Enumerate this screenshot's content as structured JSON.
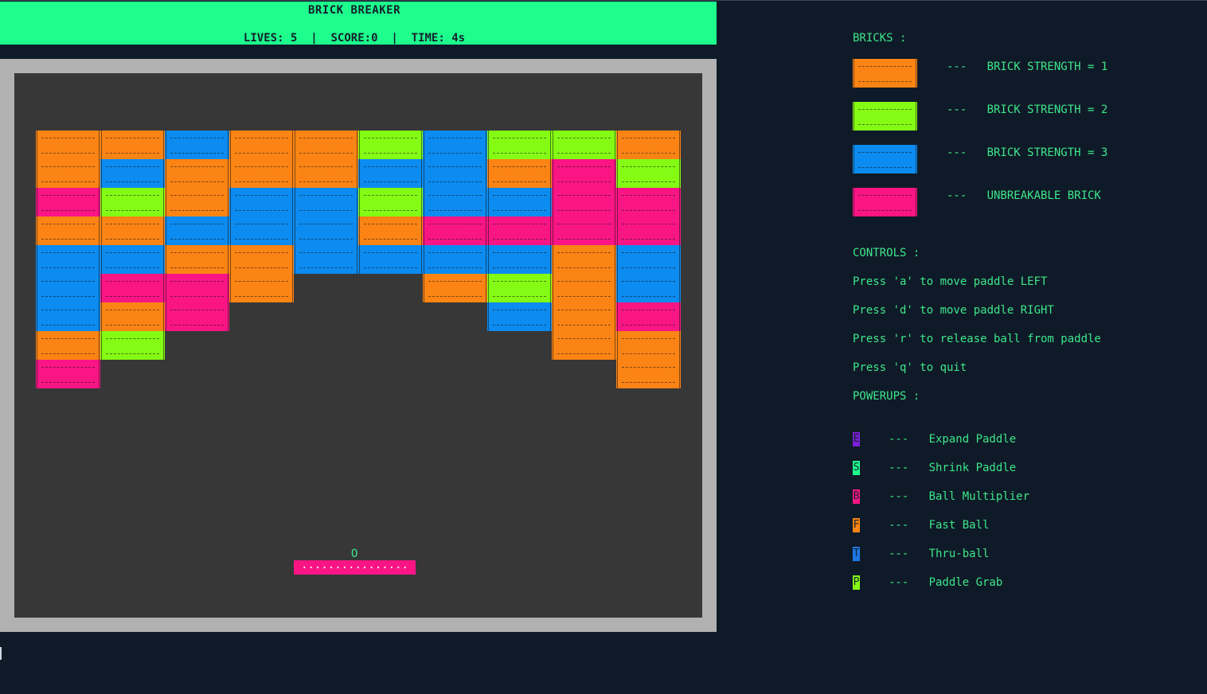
{
  "colors": {
    "background": "#0f1a28",
    "header_bg": "#1dfe8d",
    "text": "#3ee68a",
    "frame": "#b1b1b1",
    "arena": "#373737",
    "brick_strength_1": "#fc8414",
    "brick_strength_2": "#84fb14",
    "brick_strength_3": "#0c8bf0",
    "brick_unbreakable": "#fa1585",
    "paddle": "#fa1585"
  },
  "header": {
    "title": "BRICK BREAKER",
    "status": "LIVES: 5  |  SCORE:0  |  TIME: 4s"
  },
  "game": {
    "ball_char": "O",
    "paddle_text": "................",
    "brick_grid": [
      [
        "O",
        "O",
        "B",
        "O",
        "O",
        "G",
        "B",
        "G",
        "G",
        "O"
      ],
      [
        "O",
        "B",
        "O",
        "O",
        "O",
        "B",
        "B",
        "O",
        "P",
        "G"
      ],
      [
        "P",
        "G",
        "O",
        "B",
        "B",
        "G",
        "B",
        "B",
        "P",
        "P"
      ],
      [
        "O",
        "O",
        "B",
        "B",
        "B",
        "O",
        "P",
        "P",
        "P",
        "P"
      ],
      [
        "B",
        "B",
        "O",
        "O",
        "B",
        "B",
        "B",
        "B",
        "O",
        "B"
      ],
      [
        "B",
        "P",
        "P",
        "O",
        ".",
        ".",
        "O",
        "G",
        "O",
        "B"
      ],
      [
        "B",
        "O",
        "P",
        ".",
        ".",
        ".",
        ".",
        "B",
        "O",
        "P"
      ],
      [
        "O",
        "G",
        ".",
        ".",
        ".",
        ".",
        ".",
        ".",
        "O",
        "O"
      ],
      [
        "P",
        ".",
        ".",
        ".",
        ".",
        ".",
        ".",
        ".",
        ".",
        "O"
      ]
    ]
  },
  "legend": {
    "bricks_heading": "BRICKS :",
    "bricks": [
      {
        "desc": "---   BRICK STRENGTH = 1",
        "color": "#fc8414"
      },
      {
        "desc": "---   BRICK STRENGTH = 2",
        "color": "#84fb14"
      },
      {
        "desc": "---   BRICK STRENGTH = 3",
        "color": "#0c8bf0"
      },
      {
        "desc": "---   UNBREAKABLE BRICK",
        "color": "#fa1585"
      }
    ],
    "controls_heading": "CONTROLS :",
    "controls": [
      "Press 'a' to move paddle LEFT",
      "Press 'd' to move paddle RIGHT",
      "Press 'r' to release ball from paddle",
      "Press 'q' to quit"
    ],
    "powerups_heading": "POWERUPS :",
    "powerups": [
      {
        "key": "E",
        "desc": "---   Expand Paddle",
        "color": "#7a1fd6",
        "icon": "expand-paddle-icon"
      },
      {
        "key": "S",
        "desc": "---   Shrink Paddle",
        "color": "#1dfe8d",
        "icon": "shrink-paddle-icon"
      },
      {
        "key": "B",
        "desc": "---   Ball Multiplier",
        "color": "#fa1585",
        "icon": "ball-multiplier-icon"
      },
      {
        "key": "F",
        "desc": "---   Fast Ball",
        "color": "#fc8414",
        "icon": "fast-ball-icon"
      },
      {
        "key": "T",
        "desc": "---   Thru-ball",
        "color": "#1c79e6",
        "icon": "thru-ball-icon"
      },
      {
        "key": "P",
        "desc": "---   Paddle Grab",
        "color": "#84fb14",
        "icon": "paddle-grab-icon"
      }
    ]
  }
}
